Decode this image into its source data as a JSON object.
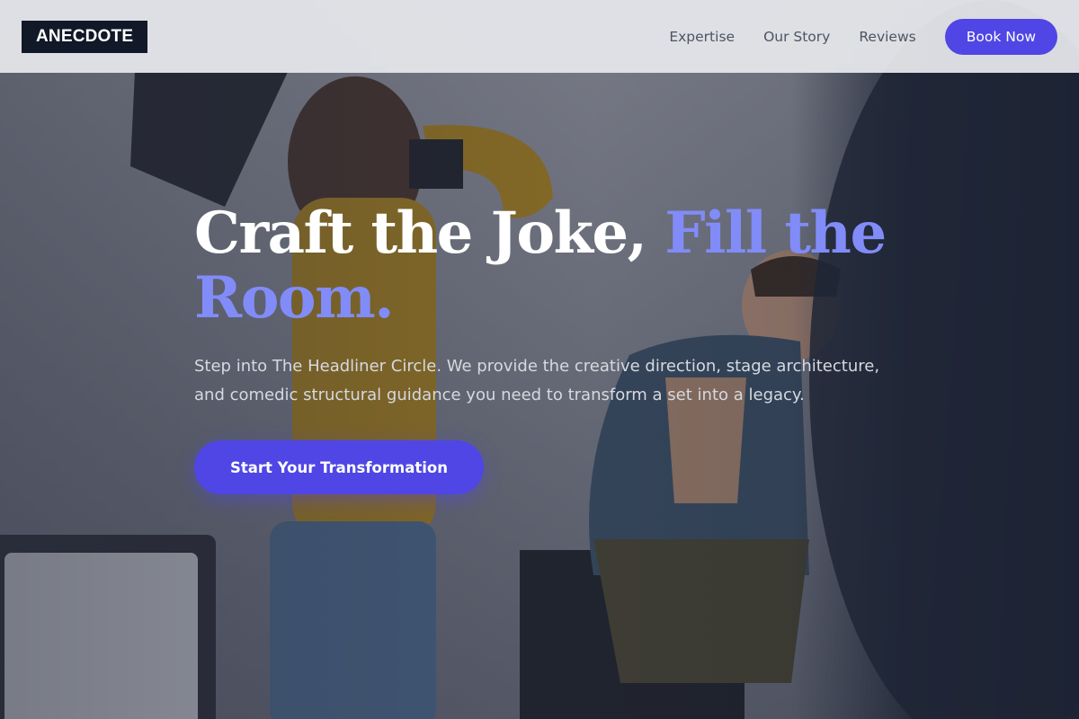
{
  "brand": {
    "logo": "ANECDOTE"
  },
  "nav": {
    "links": [
      "Expertise",
      "Our Story",
      "Reviews"
    ],
    "cta": "Book Now"
  },
  "hero": {
    "headline_white": "Craft the Joke, ",
    "headline_accent": "Fill the Room.",
    "subtext": "Step into The Headliner Circle. We provide the creative direction, stage architecture, and comedic structural guidance you need to transform a set into a legacy.",
    "cta": "Start Your Transformation"
  },
  "colors": {
    "accent": "#4f46e5",
    "accent_light": "#818cf8",
    "logo_bg": "#111827",
    "header_bg": "#e5e7eb"
  },
  "background": {
    "description_icon": "photo-studio-scene"
  }
}
